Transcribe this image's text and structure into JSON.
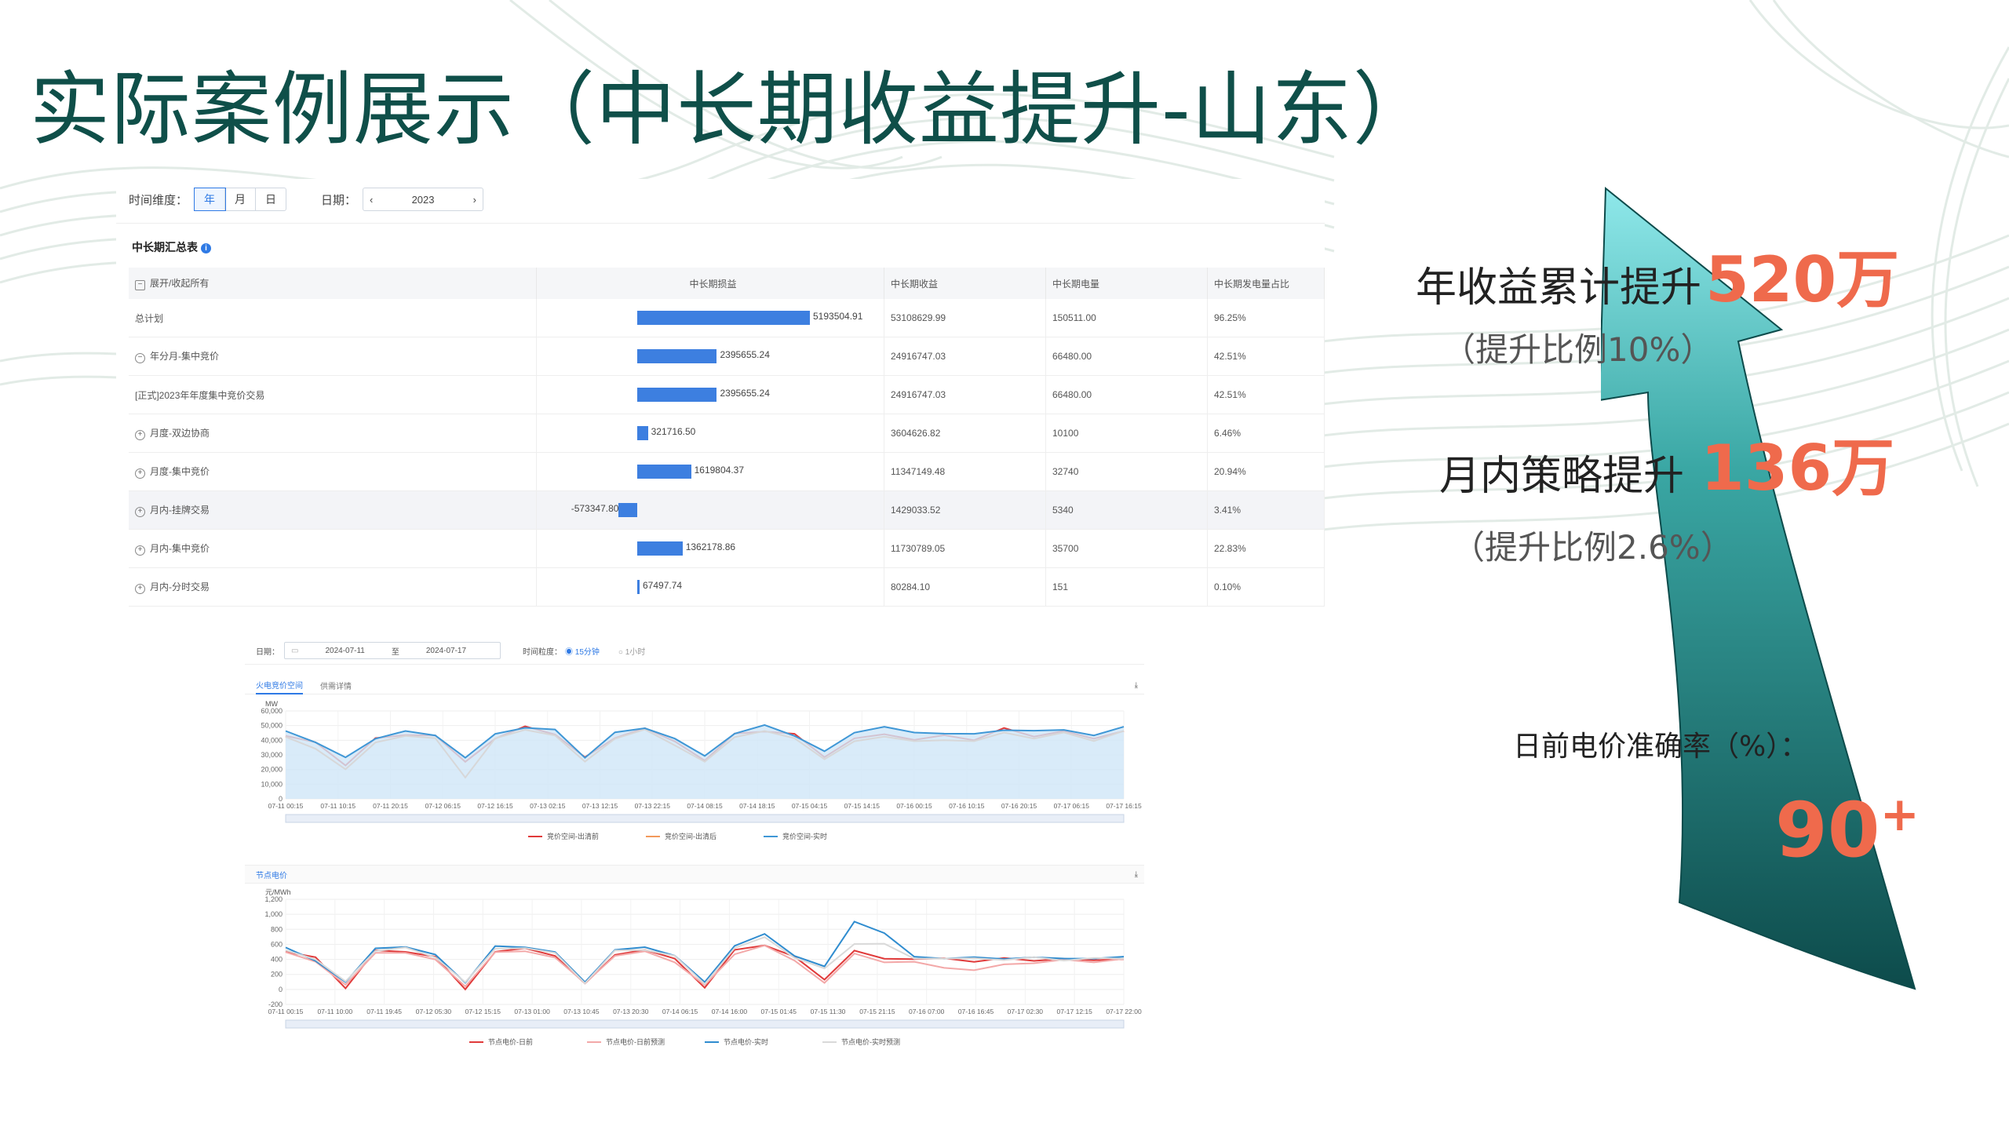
{
  "title": "实际案例展示（中长期收益提升-山东）",
  "filters": {
    "time_dim_label": "时间维度：",
    "time_options": [
      "年",
      "月",
      "日"
    ],
    "time_selected": "年",
    "date_label": "日期：",
    "date_value": "2023",
    "prev": "‹",
    "next": "›"
  },
  "summary": {
    "title": "中长期汇总表",
    "info": "i",
    "columns": [
      "展开/收起所有",
      "中长期损益",
      "中长期收益",
      "中长期电量",
      "中长期发电量占比"
    ],
    "rows": [
      {
        "name": "总计划",
        "pl": "5193504.91",
        "pl_value": 5193504.91,
        "income": "53108629.99",
        "energy": "150511.00",
        "ratio": "96.25%",
        "expand": ""
      },
      {
        "name": "年分月-集中竞价",
        "pl": "2395655.24",
        "pl_value": 2395655.24,
        "income": "24916747.03",
        "energy": "66480.00",
        "ratio": "42.51%",
        "expand": "−"
      },
      {
        "name": "[正式]2023年年度集中竞价交易",
        "pl": "2395655.24",
        "pl_value": 2395655.24,
        "income": "24916747.03",
        "energy": "66480.00",
        "ratio": "42.51%",
        "expand": ""
      },
      {
        "name": "月度-双边协商",
        "pl": "321716.50",
        "pl_value": 321716.5,
        "income": "3604626.82",
        "energy": "10100",
        "ratio": "6.46%",
        "expand": "+"
      },
      {
        "name": "月度-集中竞价",
        "pl": "1619804.37",
        "pl_value": 1619804.37,
        "income": "11347149.48",
        "energy": "32740",
        "ratio": "20.94%",
        "expand": "+"
      },
      {
        "name": "月内-挂牌交易",
        "pl": "-573347.80",
        "pl_value": -573347.8,
        "income": "1429033.52",
        "energy": "5340",
        "ratio": "3.41%",
        "expand": "+",
        "highlight": true
      },
      {
        "name": "月内-集中竞价",
        "pl": "1362178.86",
        "pl_value": 1362178.86,
        "income": "11730789.05",
        "energy": "35700",
        "ratio": "22.83%",
        "expand": "+"
      },
      {
        "name": "月内-分时交易",
        "pl": "67497.74",
        "pl_value": 67497.74,
        "income": "80284.10",
        "energy": "151",
        "ratio": "0.10%",
        "expand": "+"
      }
    ]
  },
  "charts_panel": {
    "date_label": "日期：",
    "date_from": "2024-07-11",
    "date_sep": "至",
    "date_to": "2024-07-17",
    "gran_label": "时间粒度：",
    "gran_options": [
      "15分钟",
      "1小时"
    ],
    "gran_selected": "15分钟",
    "tabs1": [
      "火电竞价空间",
      "供需详情"
    ],
    "tabs2": [
      "节点电价"
    ],
    "download": "⤓"
  },
  "chart_data": [
    {
      "type": "line",
      "title": "",
      "ylabel": "MW",
      "ylim": [
        0,
        60000
      ],
      "yticks": [
        "60,000",
        "50,000",
        "40,000",
        "30,000",
        "20,000",
        "10,000",
        "0"
      ],
      "xticks": [
        "07-11 00:15",
        "07-11 10:15",
        "07-11 20:15",
        "07-12 06:15",
        "07-12 16:15",
        "07-13 02:15",
        "07-13 12:15",
        "07-13 22:15",
        "07-14 08:15",
        "07-14 18:15",
        "07-15 04:15",
        "07-15 14:15",
        "07-16 00:15",
        "07-16 10:15",
        "07-16 20:15",
        "07-17 06:15",
        "07-17 16:15"
      ],
      "series": [
        {
          "name": "竞价空间-出清前",
          "color": "#e03a3a",
          "values": [
            43000,
            38000,
            24000,
            40000,
            45000,
            42000,
            26000,
            41000,
            49000,
            45000,
            27000,
            43000,
            47000,
            40000,
            26000,
            44000,
            47000,
            43000,
            30000,
            40000,
            45000,
            40000,
            43000,
            41000,
            47000,
            44000,
            45000,
            42000,
            46000
          ]
        },
        {
          "name": "竞价空间-出清后",
          "color": "#f29a5b",
          "values": [
            41000,
            35000,
            20000,
            38000,
            44000,
            40000,
            16000,
            40000,
            48000,
            43000,
            25000,
            42000,
            46000,
            38000,
            24000,
            43000,
            46000,
            41000,
            28000,
            38000,
            44000,
            38000,
            41000,
            39000,
            45000,
            42000,
            44000,
            41000,
            45000
          ]
        },
        {
          "name": "竞价空间-实时",
          "color": "#3f97d6",
          "values": [
            45000,
            40000,
            27000,
            42000,
            46000,
            43000,
            29000,
            43000,
            50000,
            46000,
            29000,
            45000,
            48000,
            42000,
            28000,
            46000,
            49000,
            44000,
            32000,
            45000,
            50000,
            44000,
            46000,
            43000,
            48000,
            46000,
            47000,
            44000,
            48000
          ]
        }
      ]
    },
    {
      "type": "line",
      "title": "",
      "ylabel": "元/MWh",
      "ylim": [
        -200,
        1200
      ],
      "yticks": [
        "1,200",
        "1,000",
        "800",
        "600",
        "400",
        "200",
        "0",
        "-200"
      ],
      "xticks": [
        "07-11 00:15",
        "07-11 10:00",
        "07-11 19:45",
        "07-12 05:30",
        "07-12 15:15",
        "07-13 01:00",
        "07-13 10:45",
        "07-13 20:30",
        "07-14 06:15",
        "07-14 16:00",
        "07-15 01:45",
        "07-15 11:30",
        "07-15 21:15",
        "07-16 07:00",
        "07-16 16:45",
        "07-17 02:30",
        "07-17 12:15",
        "07-17 22:00"
      ],
      "series": [
        {
          "name": "节点电价-日前",
          "color": "#e03a3a",
          "values": [
            500,
            420,
            30,
            500,
            520,
            420,
            10,
            500,
            540,
            460,
            60,
            480,
            510,
            420,
            20,
            520,
            600,
            420,
            150,
            500,
            420,
            400,
            410,
            380,
            400,
            400,
            390,
            400,
            400
          ]
        },
        {
          "name": "节点电价-日前预测",
          "color": "#f3a8a8",
          "values": [
            480,
            380,
            60,
            480,
            500,
            380,
            60,
            480,
            520,
            420,
            80,
            460,
            490,
            380,
            40,
            480,
            580,
            380,
            100,
            460,
            380,
            350,
            300,
            250,
            330,
            360,
            380,
            380,
            390
          ]
        },
        {
          "name": "节点电价-实时",
          "color": "#2f8ccf",
          "values": [
            540,
            400,
            80,
            560,
            560,
            460,
            100,
            560,
            580,
            480,
            110,
            520,
            560,
            460,
            80,
            600,
            720,
            460,
            300,
            900,
            760,
            420,
            430,
            410,
            420,
            420,
            410,
            420,
            420
          ]
        },
        {
          "name": "节点电价-实时预测",
          "color": "#d9d9d9",
          "values": [
            520,
            410,
            90,
            530,
            540,
            440,
            90,
            540,
            560,
            470,
            100,
            500,
            540,
            440,
            70,
            560,
            680,
            440,
            260,
            620,
            600,
            410,
            420,
            400,
            410,
            410,
            400,
            410,
            410
          ]
        }
      ]
    }
  ],
  "kpi": {
    "annual_label": "年收益累计提升",
    "annual_value": "520万",
    "annual_sub": "（提升比例10%）",
    "monthly_label": "月内策略提升",
    "monthly_value": "136万",
    "monthly_sub": "（提升比例2.6%）",
    "accuracy_label": "日前电价准确率（%）：",
    "accuracy_value": "90",
    "accuracy_plus": "+"
  },
  "colors": {
    "title": "#0f4f49",
    "accent": "#ef6a4c",
    "bar": "#3d7fe0",
    "arrow_top": "#8fe8ea",
    "arrow_bottom": "#0d4b4b"
  }
}
